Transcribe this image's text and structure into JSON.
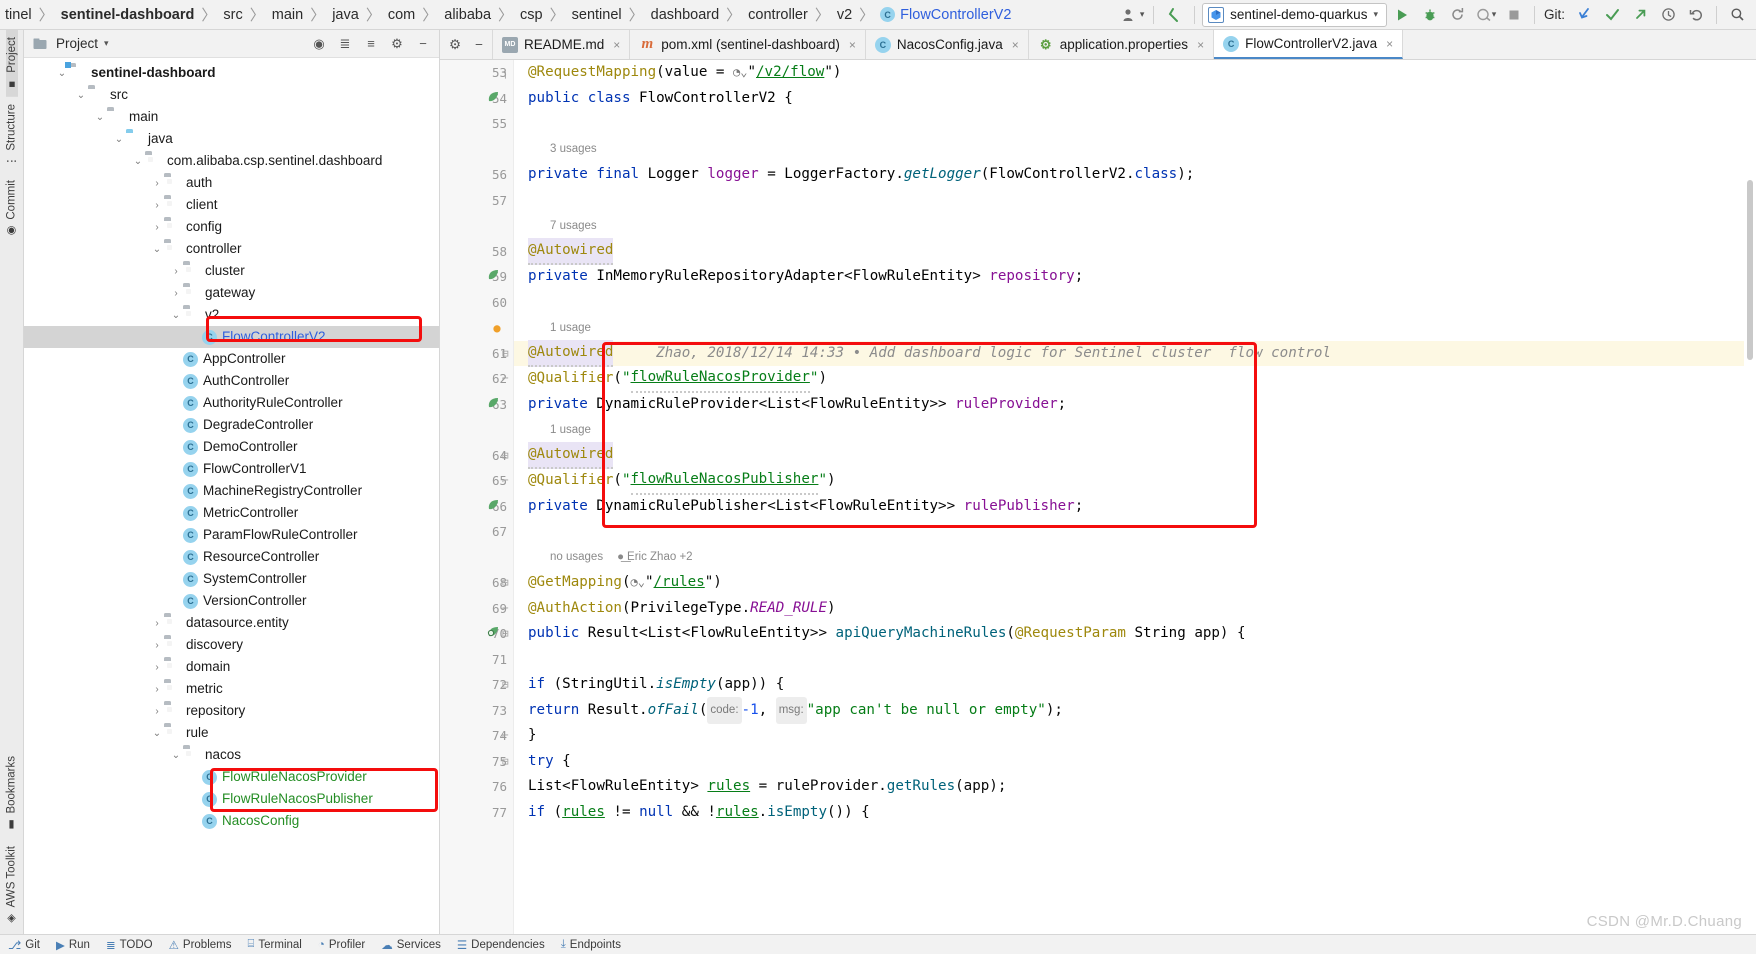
{
  "breadcrumb": {
    "items": [
      "tinel",
      "sentinel-dashboard",
      "src",
      "main",
      "java",
      "com",
      "alibaba",
      "csp",
      "sentinel",
      "dashboard",
      "controller",
      "v2",
      "FlowControllerV2"
    ],
    "separator": "〉"
  },
  "toolbar": {
    "run_config": "sentinel-demo-quarkus",
    "git_label": "Git:",
    "icons": [
      "profile-icon",
      "back-arrow-icon",
      "run-icon",
      "debug-icon",
      "rerun-icon",
      "coverage-icon",
      "stop-icon",
      "git-update-icon",
      "git-commit-icon",
      "git-push-icon",
      "history-icon",
      "undo-icon",
      "search-icon"
    ]
  },
  "project_panel": {
    "title": "Project",
    "tree": [
      {
        "depth": 1,
        "twist": "⌄",
        "icon": "folder-module",
        "label": "sentinel-dashboard",
        "style": "bold"
      },
      {
        "depth": 2,
        "twist": "⌄",
        "icon": "folder",
        "label": "src",
        "style": ""
      },
      {
        "depth": 3,
        "twist": "⌄",
        "icon": "folder",
        "label": "main",
        "style": ""
      },
      {
        "depth": 4,
        "twist": "⌄",
        "icon": "folder-blue",
        "label": "java",
        "style": ""
      },
      {
        "depth": 5,
        "twist": "⌄",
        "icon": "folder-pkg",
        "label": "com.alibaba.csp.sentinel.dashboard",
        "style": ""
      },
      {
        "depth": 6,
        "twist": "›",
        "icon": "folder-pkg",
        "label": "auth",
        "style": ""
      },
      {
        "depth": 6,
        "twist": "›",
        "icon": "folder-pkg",
        "label": "client",
        "style": ""
      },
      {
        "depth": 6,
        "twist": "›",
        "icon": "folder-pkg",
        "label": "config",
        "style": ""
      },
      {
        "depth": 6,
        "twist": "⌄",
        "icon": "folder-pkg",
        "label": "controller",
        "style": ""
      },
      {
        "depth": 7,
        "twist": "›",
        "icon": "folder-pkg",
        "label": "cluster",
        "style": ""
      },
      {
        "depth": 7,
        "twist": "›",
        "icon": "folder-pkg",
        "label": "gateway",
        "style": ""
      },
      {
        "depth": 7,
        "twist": "⌄",
        "icon": "folder-pkg",
        "label": "v2",
        "style": ""
      },
      {
        "depth": 8,
        "twist": "",
        "icon": "class",
        "label": "FlowControllerV2",
        "style": "blue",
        "selected": true
      },
      {
        "depth": 7,
        "twist": "",
        "icon": "class",
        "label": "AppController",
        "style": ""
      },
      {
        "depth": 7,
        "twist": "",
        "icon": "class",
        "label": "AuthController",
        "style": ""
      },
      {
        "depth": 7,
        "twist": "",
        "icon": "class",
        "label": "AuthorityRuleController",
        "style": ""
      },
      {
        "depth": 7,
        "twist": "",
        "icon": "class",
        "label": "DegradeController",
        "style": ""
      },
      {
        "depth": 7,
        "twist": "",
        "icon": "class",
        "label": "DemoController",
        "style": ""
      },
      {
        "depth": 7,
        "twist": "",
        "icon": "class",
        "label": "FlowControllerV1",
        "style": ""
      },
      {
        "depth": 7,
        "twist": "",
        "icon": "class",
        "label": "MachineRegistryController",
        "style": ""
      },
      {
        "depth": 7,
        "twist": "",
        "icon": "class",
        "label": "MetricController",
        "style": ""
      },
      {
        "depth": 7,
        "twist": "",
        "icon": "class",
        "label": "ParamFlowRuleController",
        "style": ""
      },
      {
        "depth": 7,
        "twist": "",
        "icon": "class",
        "label": "ResourceController",
        "style": ""
      },
      {
        "depth": 7,
        "twist": "",
        "icon": "class",
        "label": "SystemController",
        "style": ""
      },
      {
        "depth": 7,
        "twist": "",
        "icon": "class",
        "label": "VersionController",
        "style": ""
      },
      {
        "depth": 6,
        "twist": "›",
        "icon": "folder-pkg",
        "label": "datasource.entity",
        "style": ""
      },
      {
        "depth": 6,
        "twist": "›",
        "icon": "folder-pkg",
        "label": "discovery",
        "style": ""
      },
      {
        "depth": 6,
        "twist": "›",
        "icon": "folder-pkg",
        "label": "domain",
        "style": ""
      },
      {
        "depth": 6,
        "twist": "›",
        "icon": "folder-pkg",
        "label": "metric",
        "style": ""
      },
      {
        "depth": 6,
        "twist": "›",
        "icon": "folder-pkg",
        "label": "repository",
        "style": ""
      },
      {
        "depth": 6,
        "twist": "⌄",
        "icon": "folder-pkg",
        "label": "rule",
        "style": ""
      },
      {
        "depth": 7,
        "twist": "⌄",
        "icon": "folder-pkg",
        "label": "nacos",
        "style": ""
      },
      {
        "depth": 8,
        "twist": "",
        "icon": "class",
        "label": "FlowRuleNacosProvider",
        "style": "green"
      },
      {
        "depth": 8,
        "twist": "",
        "icon": "class",
        "label": "FlowRuleNacosPublisher",
        "style": "green"
      },
      {
        "depth": 8,
        "twist": "",
        "icon": "class",
        "label": "NacosConfig",
        "style": "green"
      }
    ]
  },
  "left_strip": {
    "tools": [
      "Project",
      "Structure",
      "Commit"
    ],
    "bottom_tools": [
      "Bookmarks",
      "AWS Toolkit"
    ]
  },
  "editor_tabs": [
    {
      "label": "README.md",
      "icon": "markdown-icon",
      "active": false
    },
    {
      "label": "pom.xml (sentinel-dashboard)",
      "icon": "maven-icon",
      "active": false
    },
    {
      "label": "NacosConfig.java",
      "icon": "java-class-icon",
      "active": false
    },
    {
      "label": "application.properties",
      "icon": "properties-icon",
      "active": false
    },
    {
      "label": "FlowControllerV2.java",
      "icon": "java-class-icon",
      "active": true
    }
  ],
  "code": {
    "lines": [
      {
        "num": "53",
        "mark": "",
        "fold": "┐",
        "html": "<span class='anno'>@RequestMapping</span><span class='plain'>(</span><span class='plain'>value = </span><span class='webico'>◔⌄</span><span class='plain'>\"</span><span class='lnk'>/v2/flow</span><span class='plain'>\")</span>"
      },
      {
        "num": "54",
        "mark": "leaf",
        "fold": "",
        "html": "<span class='kw'>public class </span><span class='typ'>FlowControllerV2 </span><span class='plain'>{</span>"
      },
      {
        "num": "55",
        "mark": "",
        "fold": "",
        "html": ""
      },
      {
        "hint": "3 usages"
      },
      {
        "num": "56",
        "mark": "",
        "fold": "",
        "html": "    <span class='kw'>private final </span><span class='typ'>Logger </span><span class='fld'>logger </span><span class='plain'>= </span><span class='typ'>LoggerFactory</span><span class='plain'>.</span><span class='mth ital'>getLogger</span><span class='plain'>(</span><span class='typ'>FlowControllerV2</span><span class='plain'>.</span><span class='kw'>class</span><span class='plain'>);</span>"
      },
      {
        "num": "57",
        "mark": "",
        "fold": "",
        "html": ""
      },
      {
        "hint": "7 usages"
      },
      {
        "num": "58",
        "mark": "",
        "fold": "",
        "html": "    <span class='anno annohl squig'>@Autowired</span>"
      },
      {
        "num": "59",
        "mark": "leaf",
        "fold": "",
        "html": "    <span class='kw'>private </span><span class='typ'>InMemoryRuleRepositoryAdapter</span><span class='plain'>&lt;</span><span class='typ'>FlowRuleEntity</span><span class='plain'>&gt; </span><span class='fld'>repository</span><span class='plain'>;</span>"
      },
      {
        "num": "60",
        "mark": "",
        "fold": "",
        "html": ""
      },
      {
        "hint": "1 usage",
        "bulb": true
      },
      {
        "num": "61",
        "mark": "",
        "fold": "⊟",
        "hl": true,
        "html": "    <span class='anno annohl squig'>@Autowired</span><span class='cmt'>     Zhao, 2018/12/14 14:33 • Add dashboard logic for Sentinel cluster  flow control</span>"
      },
      {
        "num": "62",
        "mark": "",
        "fold": "⌐",
        "html": "    <span class='anno'>@Qualifier</span><span class='plain'>(</span><span class='str'>\"</span><span class='lnk squig'>flowRuleNacosProvider</span><span class='str'>\"</span><span class='plain'>)</span>"
      },
      {
        "num": "63",
        "mark": "leaf",
        "fold": "",
        "html": "    <span class='kw'>private </span><span class='typ'>DynamicRuleProvider</span><span class='plain'>&lt;</span><span class='typ'>List</span><span class='plain'>&lt;</span><span class='typ'>FlowRuleEntity</span><span class='plain'>&gt;&gt; </span><span class='fld'>ruleProvider</span><span class='plain'>;</span>"
      },
      {
        "hint": "1 usage"
      },
      {
        "num": "64",
        "mark": "",
        "fold": "⊟",
        "html": "    <span class='anno annohl squig'>@Autowired</span>"
      },
      {
        "num": "65",
        "mark": "",
        "fold": "⌐",
        "html": "    <span class='anno'>@Qualifier</span><span class='plain'>(</span><span class='str'>\"</span><span class='lnk squig'>flowRuleNacosPublisher</span><span class='str'>\"</span><span class='plain'>)</span>"
      },
      {
        "num": "66",
        "mark": "leaf",
        "fold": "",
        "html": "    <span class='kw'>private </span><span class='typ'>DynamicRulePublisher</span><span class='plain'>&lt;</span><span class='typ'>List</span><span class='plain'>&lt;</span><span class='typ'>FlowRuleEntity</span><span class='plain'>&gt;&gt; </span><span class='fld'>rulePublisher</span><span class='plain'>;</span>"
      },
      {
        "num": "67",
        "mark": "",
        "fold": "",
        "html": ""
      },
      {
        "hint": "no usages",
        "author": "Eric Zhao +2"
      },
      {
        "num": "68",
        "mark": "",
        "fold": "⊟",
        "html": "    <span class='anno'>@GetMapping</span><span class='plain'>(</span><span class='webico'>◔⌄</span><span class='plain'>\"</span><span class='lnk'>/rules</span><span class='plain'>\")</span>"
      },
      {
        "num": "69",
        "mark": "",
        "fold": "⌐",
        "html": "    <span class='anno'>@AuthAction</span><span class='plain'>(</span><span class='typ'>PrivilegeType</span><span class='plain'>.</span><span class='fld ital'>READ_RULE</span><span class='plain'>)</span>"
      },
      {
        "num": "70",
        "mark": "override",
        "fold": "⊟",
        "html": "    <span class='kw'>public </span><span class='typ'>Result</span><span class='plain'>&lt;</span><span class='typ'>List</span><span class='plain'>&lt;</span><span class='typ'>FlowRuleEntity</span><span class='plain'>&gt;&gt; </span><span class='mth'>apiQueryMachineRules</span><span class='plain'>(</span><span class='anno'>@RequestParam </span><span class='typ'>String </span><span class='plain'>app) {</span>"
      },
      {
        "num": "71",
        "mark": "",
        "fold": "",
        "html": ""
      },
      {
        "num": "72",
        "mark": "",
        "fold": "⊟",
        "html": "        <span class='kw'>if </span><span class='plain'>(</span><span class='typ'>StringUtil</span><span class='plain'>.</span><span class='mth ital'>isEmpty</span><span class='plain'>(</span><span class='plain'>app</span><span class='plain'>)) {</span>"
      },
      {
        "num": "73",
        "mark": "",
        "fold": "",
        "html": "            <span class='kw'>return </span><span class='typ'>Result</span><span class='plain'>.</span><span class='mth ital'>ofFail</span><span class='plain'>(</span><span class='param-hint'>code:</span> <span class='num'>-1</span><span class='plain'>, </span><span class='param-hint'>msg:</span> <span class='str'>\"app can't be null or empty\"</span><span class='plain'>);</span>"
      },
      {
        "num": "74",
        "mark": "",
        "fold": "⌐",
        "html": "        <span class='plain'>}</span>"
      },
      {
        "num": "75",
        "mark": "",
        "fold": "⊟",
        "html": "        <span class='kw'>try </span><span class='plain'>{</span>"
      },
      {
        "num": "76",
        "mark": "",
        "fold": "",
        "html": "            <span class='typ'>List</span><span class='plain'>&lt;</span><span class='typ'>FlowRuleEntity</span><span class='plain'>&gt; </span><span class='lnk'>rules</span><span class='plain'> = ruleProvider.</span><span class='mth'>getRules</span><span class='plain'>(app);</span>"
      },
      {
        "num": "77",
        "mark": "",
        "fold": "",
        "html": "            <span class='kw'>if </span><span class='plain'>(</span><span class='lnk'>rules</span><span class='plain'> != </span><span class='kw'>null</span><span class='plain'> &amp;&amp; !</span><span class='lnk'>rules</span><span class='plain'>.</span><span class='mth'>isEmpty</span><span class='plain'>()) {</span>"
      }
    ]
  },
  "statusbar": {
    "items": [
      "Git",
      "Run",
      "TODO",
      "Problems",
      "Terminal",
      "Profiler",
      "Services",
      "Dependencies",
      "Endpoints"
    ]
  },
  "watermark": "CSDN @Mr.D.Chuang",
  "colors": {
    "accent_blue": "#4a88c7",
    "highlight_red": "#f40d0d",
    "run_green": "#499c54",
    "selection_gray": "#d4d4d4"
  }
}
